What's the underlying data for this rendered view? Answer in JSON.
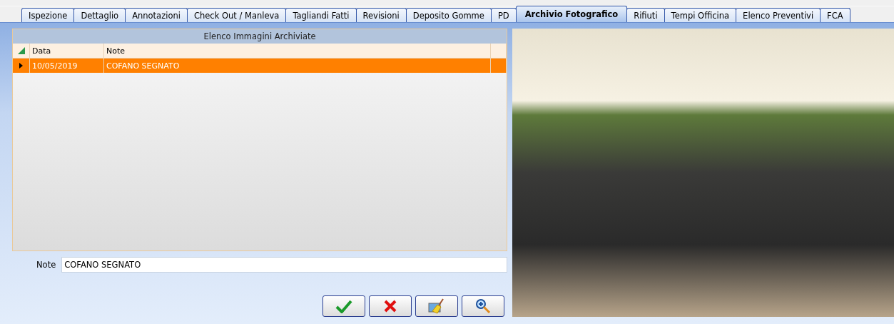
{
  "tabs": [
    {
      "label": "Ispezione",
      "selected": false
    },
    {
      "label": "Dettaglio",
      "selected": false
    },
    {
      "label": "Annotazioni",
      "selected": false
    },
    {
      "label": "Check Out / Manleva",
      "selected": false
    },
    {
      "label": "Tagliandi Fatti",
      "selected": false
    },
    {
      "label": "Revisioni",
      "selected": false
    },
    {
      "label": "Deposito Gomme",
      "selected": false
    },
    {
      "label": "PD",
      "selected": false
    },
    {
      "label": "Archivio Fotografico",
      "selected": true
    },
    {
      "label": "Rifiuti",
      "selected": false
    },
    {
      "label": "Tempi Officina",
      "selected": false
    },
    {
      "label": "Elenco Preventivi",
      "selected": false
    },
    {
      "label": "FCA",
      "selected": false
    }
  ],
  "grid": {
    "title": "Elenco Immagini Archiviate",
    "columns": [
      "Data",
      "Note"
    ],
    "rows": [
      {
        "cells": [
          "10/05/2019",
          "COFANO SEGNATO"
        ],
        "selected": true
      }
    ]
  },
  "note": {
    "label": "Note",
    "value": "COFANO SEGNATO"
  },
  "buttons": [
    {
      "kind": "confirm"
    },
    {
      "kind": "cancel"
    },
    {
      "kind": "clear"
    },
    {
      "kind": "zoom"
    }
  ]
}
